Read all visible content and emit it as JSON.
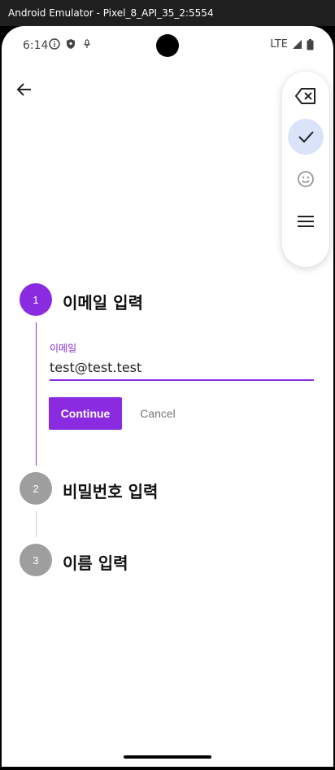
{
  "window": {
    "title": "Android Emulator - Pixel_8_API_35_2:5554"
  },
  "statusbar": {
    "time": "6:14",
    "network": "LTE"
  },
  "stepper": {
    "steps": [
      {
        "number": "1",
        "title": "이메일 입력",
        "state": "active",
        "color": "#8a2be2"
      },
      {
        "number": "2",
        "title": "비밀번호 입력",
        "state": "inactive",
        "color": "#9e9e9e"
      },
      {
        "number": "3",
        "title": "이름 입력",
        "state": "inactive",
        "color": "#9e9e9e"
      }
    ]
  },
  "email_field": {
    "label": "이메일",
    "value": "test@test.test"
  },
  "actions": {
    "continue_label": "Continue",
    "cancel_label": "Cancel"
  },
  "keyboard_toolbar": {
    "items": [
      {
        "icon": "backspace-icon"
      },
      {
        "icon": "check-icon",
        "active": true
      },
      {
        "icon": "emoji-icon"
      },
      {
        "icon": "menu-icon"
      }
    ]
  },
  "colors": {
    "accent": "#8a2be2",
    "inactive": "#9e9e9e",
    "toolbar_active": "#dbe3fb"
  }
}
